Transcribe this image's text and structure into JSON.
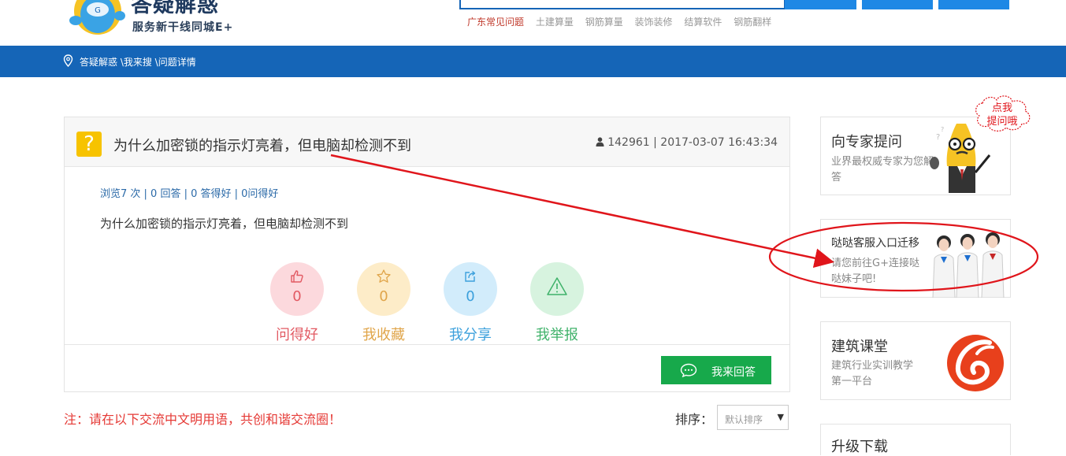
{
  "header": {
    "logo_title": "答疑解惑",
    "logo_subtitle": "服务新干线同城E+",
    "hot_links": [
      "广东常见问题",
      "土建算量",
      "钢筋算量",
      "装饰装修",
      "结算软件",
      "钢筋翻样"
    ]
  },
  "breadcrumb": {
    "text": "答疑解惑 \\我来搜 \\问题详情"
  },
  "question": {
    "icon_glyph": "?",
    "title": "为什么加密锁的指示灯亮着，但电脑却检测不到",
    "user_id": "142961",
    "separator": "|",
    "datetime": "2017-03-07 16:43:34",
    "stats": "浏览7 次 | 0 回答 | 0 答得好 | 0问得好",
    "body": "为什么加密锁的指示灯亮着，但电脑却检测不到"
  },
  "actions": [
    {
      "label": "问得好",
      "count": "0",
      "color": "#e25a63",
      "bg": "#fcd9dd"
    },
    {
      "label": "我收藏",
      "count": "0",
      "color": "#e0a54a",
      "bg": "#fdecc8"
    },
    {
      "label": "我分享",
      "count": "0",
      "color": "#3ca0dc",
      "bg": "#d2ecfb"
    },
    {
      "label": "我举报",
      "count": "",
      "color": "#3fb26a",
      "bg": "#d7f3df"
    }
  ],
  "answer_button": {
    "label": "我来回答",
    "color": "#17a94b"
  },
  "notice": "注：请在以下交流中文明用语，共创和谐交流圈！",
  "sort": {
    "label": "排序：",
    "selected": "默认排序"
  },
  "sidebar": {
    "ask_expert": {
      "title": "向专家提问",
      "desc": "业界最权威专家为您解答",
      "bubble_line1": "点我",
      "bubble_line2": "提问哦"
    },
    "customer_service": {
      "title": "哒哒客服入口迁移",
      "desc": "请您前往G+连接哒哒妹子吧!"
    },
    "classroom": {
      "title": "建筑课堂",
      "desc": "建筑行业实训教学第一平台"
    },
    "upgrade": {
      "title": "升级下载"
    }
  },
  "colors": {
    "brand_blue": "#1565b7",
    "annotation_red": "#e0151b",
    "notice_red": "#e53935"
  }
}
